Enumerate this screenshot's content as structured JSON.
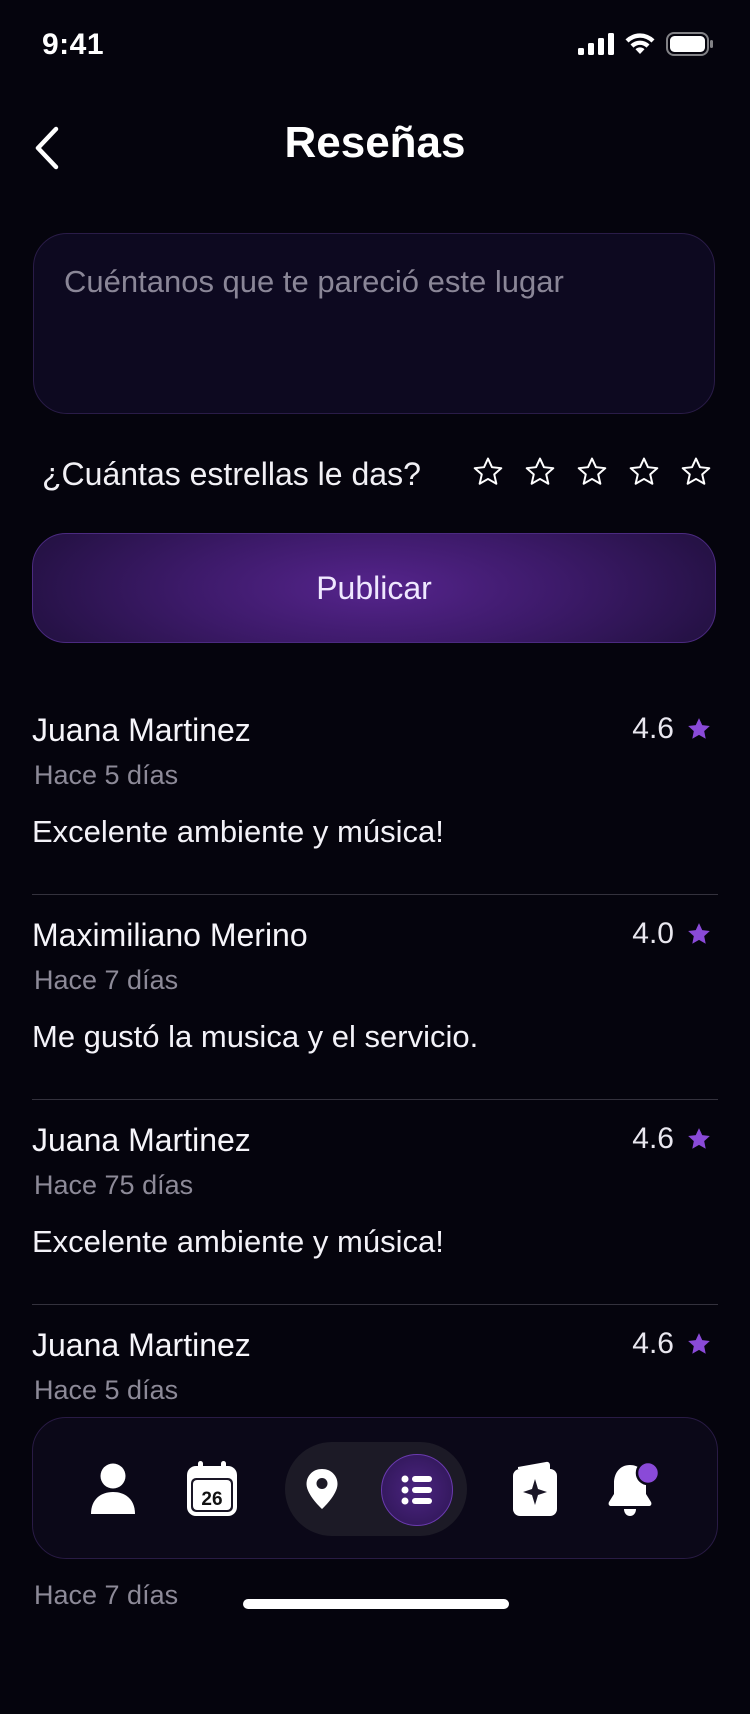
{
  "status_bar": {
    "time": "9:41"
  },
  "header": {
    "title": "Reseñas"
  },
  "review_form": {
    "placeholder": "Cuéntanos que te pareció este lugar",
    "value": "",
    "rating_prompt": "¿Cuántas estrellas le das?",
    "selected_stars": 0,
    "max_stars": 5,
    "publish_label": "Publicar"
  },
  "reviews": [
    {
      "name": "Juana Martinez",
      "time": "Hace 5 días",
      "text": "Excelente ambiente y música!",
      "score": "4.6"
    },
    {
      "name": "Maximiliano Merino",
      "time": "Hace 7 días",
      "text": "Me gustó la musica y el servicio.",
      "score": "4.0"
    },
    {
      "name": "Juana Martinez",
      "time": "Hace 75 días",
      "text": "Excelente ambiente y música!",
      "score": "4.6"
    },
    {
      "name": "Juana Martinez",
      "time": "Hace 5 días",
      "text": "",
      "score": "4.6"
    },
    {
      "name": "",
      "time": "Hace 7 días",
      "text": "",
      "score": ""
    }
  ],
  "bottom_nav": {
    "calendar_day": "26",
    "items": [
      "profile-icon",
      "calendar-icon",
      "location-pin-icon",
      "list-icon",
      "wallet-sparkle-icon",
      "bell-icon"
    ],
    "active": "list-icon",
    "has_notification": true
  },
  "colors": {
    "background": "#05040d",
    "accent": "#8a4ad8",
    "card": "#0d0920"
  }
}
